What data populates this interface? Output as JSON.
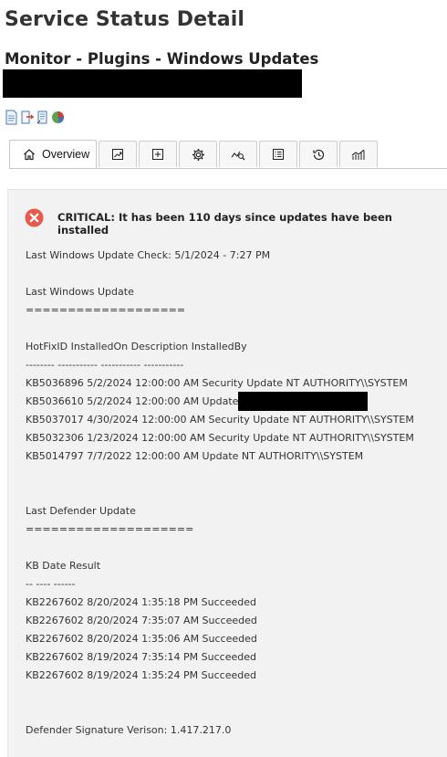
{
  "header": {
    "title": "Service Status Detail",
    "subtitle": "Monitor - Plugins - Windows Updates"
  },
  "toolbar": {
    "icons": [
      "document-icon",
      "export-icon",
      "notes-icon",
      "pie-chart-icon"
    ]
  },
  "tabs": [
    {
      "label": "Overview",
      "icon": "home-icon",
      "active": true
    },
    {
      "label": "",
      "icon": "trend-chart-icon"
    },
    {
      "label": "",
      "icon": "add-box-icon"
    },
    {
      "label": "",
      "icon": "gear-icon"
    },
    {
      "label": "",
      "icon": "graph-search-icon"
    },
    {
      "label": "",
      "icon": "list-icon"
    },
    {
      "label": "",
      "icon": "history-icon"
    },
    {
      "label": "",
      "icon": "performance-chart-icon"
    }
  ],
  "status": {
    "state": "critical",
    "color": "#e8594e",
    "text": "CRITICAL: It has been 110 days since updates have been installed"
  },
  "output_lines": [
    "Last Windows Update Check: 5/1/2024 - 7:27 PM",
    "",
    "Last Windows Update",
    "===================",
    "",
    "HotFixID InstalledOn Description InstalledBy",
    "-------- ----------- ----------- -----------",
    "KB5036896 5/2/2024 12:00:00 AM Security Update NT AUTHORITY\\\\SYSTEM",
    "KB5036610 5/2/2024 12:00:00 AM Update",
    "KB5037017 4/30/2024 12:00:00 AM Security Update NT AUTHORITY\\\\SYSTEM",
    "KB5032306 1/23/2024 12:00:00 AM Security Update NT AUTHORITY\\\\SYSTEM",
    "KB5014797 7/7/2022 12:00:00 AM Update NT AUTHORITY\\\\SYSTEM",
    "",
    "",
    "Last Defender Update",
    "====================",
    "",
    "KB Date Result",
    "-- ---- ------",
    "KB2267602 8/20/2024 1:35:18 PM Succeeded",
    "KB2267602 8/20/2024 7:35:07 AM Succeeded",
    "KB2267602 8/20/2024 1:35:06 AM Succeeded",
    "KB2267602 8/19/2024 7:35:14 PM Succeeded",
    "KB2267602 8/19/2024 1:35:24 PM Succeeded",
    "",
    "",
    "Defender Signature Verison: 1.417.217.0"
  ]
}
